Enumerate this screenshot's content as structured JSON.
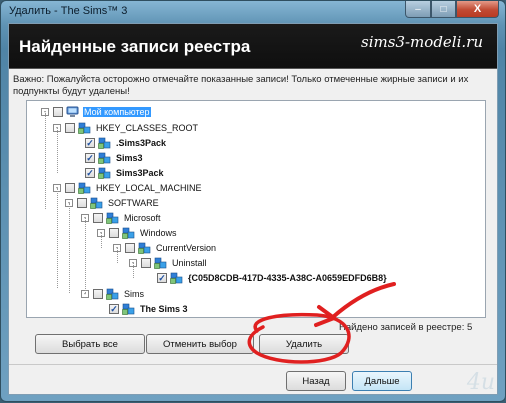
{
  "window": {
    "title": "Удалить - The Sims™ 3",
    "min": "–",
    "max": "□",
    "close": "X"
  },
  "header": {
    "title": "Найденные записи реестра",
    "watermark": "sims3-modeli.ru"
  },
  "warning": "Важно: Пожалуйста осторожно отмечайте показанные записи! Только отмеченные жирные записи и их подпункты будут удалены!",
  "tree": {
    "nodes": [
      {
        "label": "Мой компьютер",
        "selected": true,
        "bold": false,
        "checked": false,
        "expander": "-",
        "icon": "computer-icon"
      },
      {
        "label": "HKEY_CLASSES_ROOT",
        "bold": false,
        "checked": false,
        "expander": "-",
        "icon": "registry-icon"
      },
      {
        "label": ".Sims3Pack",
        "bold": true,
        "checked": true,
        "expander": "",
        "icon": "registry-icon"
      },
      {
        "label": "Sims3",
        "bold": true,
        "checked": true,
        "expander": "",
        "icon": "registry-icon"
      },
      {
        "label": "Sims3Pack",
        "bold": true,
        "checked": true,
        "expander": "",
        "icon": "registry-icon"
      },
      {
        "label": "HKEY_LOCAL_MACHINE",
        "bold": false,
        "checked": false,
        "expander": "-",
        "icon": "registry-icon"
      },
      {
        "label": "SOFTWARE",
        "bold": false,
        "checked": false,
        "expander": "-",
        "icon": "registry-icon"
      },
      {
        "label": "Microsoft",
        "bold": false,
        "checked": false,
        "expander": "-",
        "icon": "registry-icon"
      },
      {
        "label": "Windows",
        "bold": false,
        "checked": false,
        "expander": "-",
        "icon": "registry-icon"
      },
      {
        "label": "CurrentVersion",
        "bold": false,
        "checked": false,
        "expander": "-",
        "icon": "registry-icon"
      },
      {
        "label": "Uninstall",
        "bold": false,
        "checked": false,
        "expander": "-",
        "icon": "registry-icon"
      },
      {
        "label": "{C05D8CDB-417D-4335-A38C-A0659EDFD6B8}",
        "bold": true,
        "checked": true,
        "expander": "",
        "icon": "registry-icon"
      },
      {
        "label": "Sims",
        "bold": false,
        "checked": false,
        "expander": "-",
        "icon": "registry-icon"
      },
      {
        "label": "The Sims 3",
        "bold": true,
        "checked": true,
        "expander": "",
        "icon": "registry-icon"
      }
    ]
  },
  "found": "Найдено записей в реестре:  5",
  "buttons": {
    "select_all": "Выбрать все",
    "deselect": "Отменить выбор",
    "delete": "Удалить",
    "back": "Назад",
    "next": "Дальше"
  },
  "logo": "4u",
  "colors": {
    "selection": "#3399ff",
    "annotation": "#e02020",
    "header_bg": "#111111"
  }
}
